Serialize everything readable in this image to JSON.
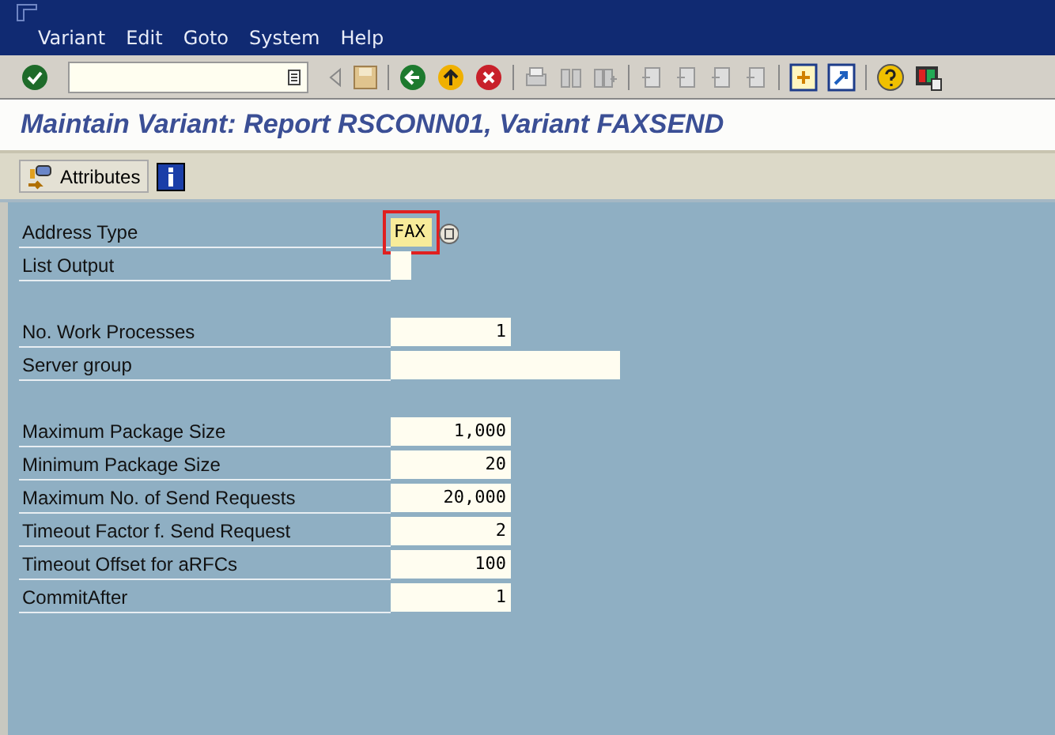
{
  "menu": [
    "Variant",
    "Edit",
    "Goto",
    "System",
    "Help"
  ],
  "title": "Maintain Variant: Report RSCONN01, Variant FAXSEND",
  "app_toolbar": {
    "button": "Attributes"
  },
  "rows": [
    {
      "kind": "code",
      "label": "Address Type",
      "value": "FAX",
      "highlighted": true
    },
    {
      "kind": "checkbox",
      "label": "List Output",
      "highlighted": false
    },
    {
      "kind": "gap"
    },
    {
      "kind": "number",
      "label": "No. Work Processes",
      "value": "1",
      "highlighted": false
    },
    {
      "kind": "text",
      "label": "Server group",
      "highlighted": false
    },
    {
      "kind": "gap"
    },
    {
      "kind": "number",
      "label": "Maximum Package Size",
      "value": "1,000",
      "highlighted": false
    },
    {
      "kind": "number",
      "label": "Minimum Package Size",
      "value": "20",
      "highlighted": false
    },
    {
      "kind": "number",
      "label": "Maximum No. of Send Requests",
      "value": "20,000",
      "highlighted": false
    },
    {
      "kind": "number",
      "label": "Timeout Factor f. Send Request",
      "value": "2",
      "highlighted": false
    },
    {
      "kind": "number",
      "label": "Timeout Offset for aRFCs",
      "value": "100",
      "highlighted": false
    },
    {
      "kind": "number",
      "label": "CommitAfter",
      "value": "1",
      "highlighted": false
    }
  ]
}
